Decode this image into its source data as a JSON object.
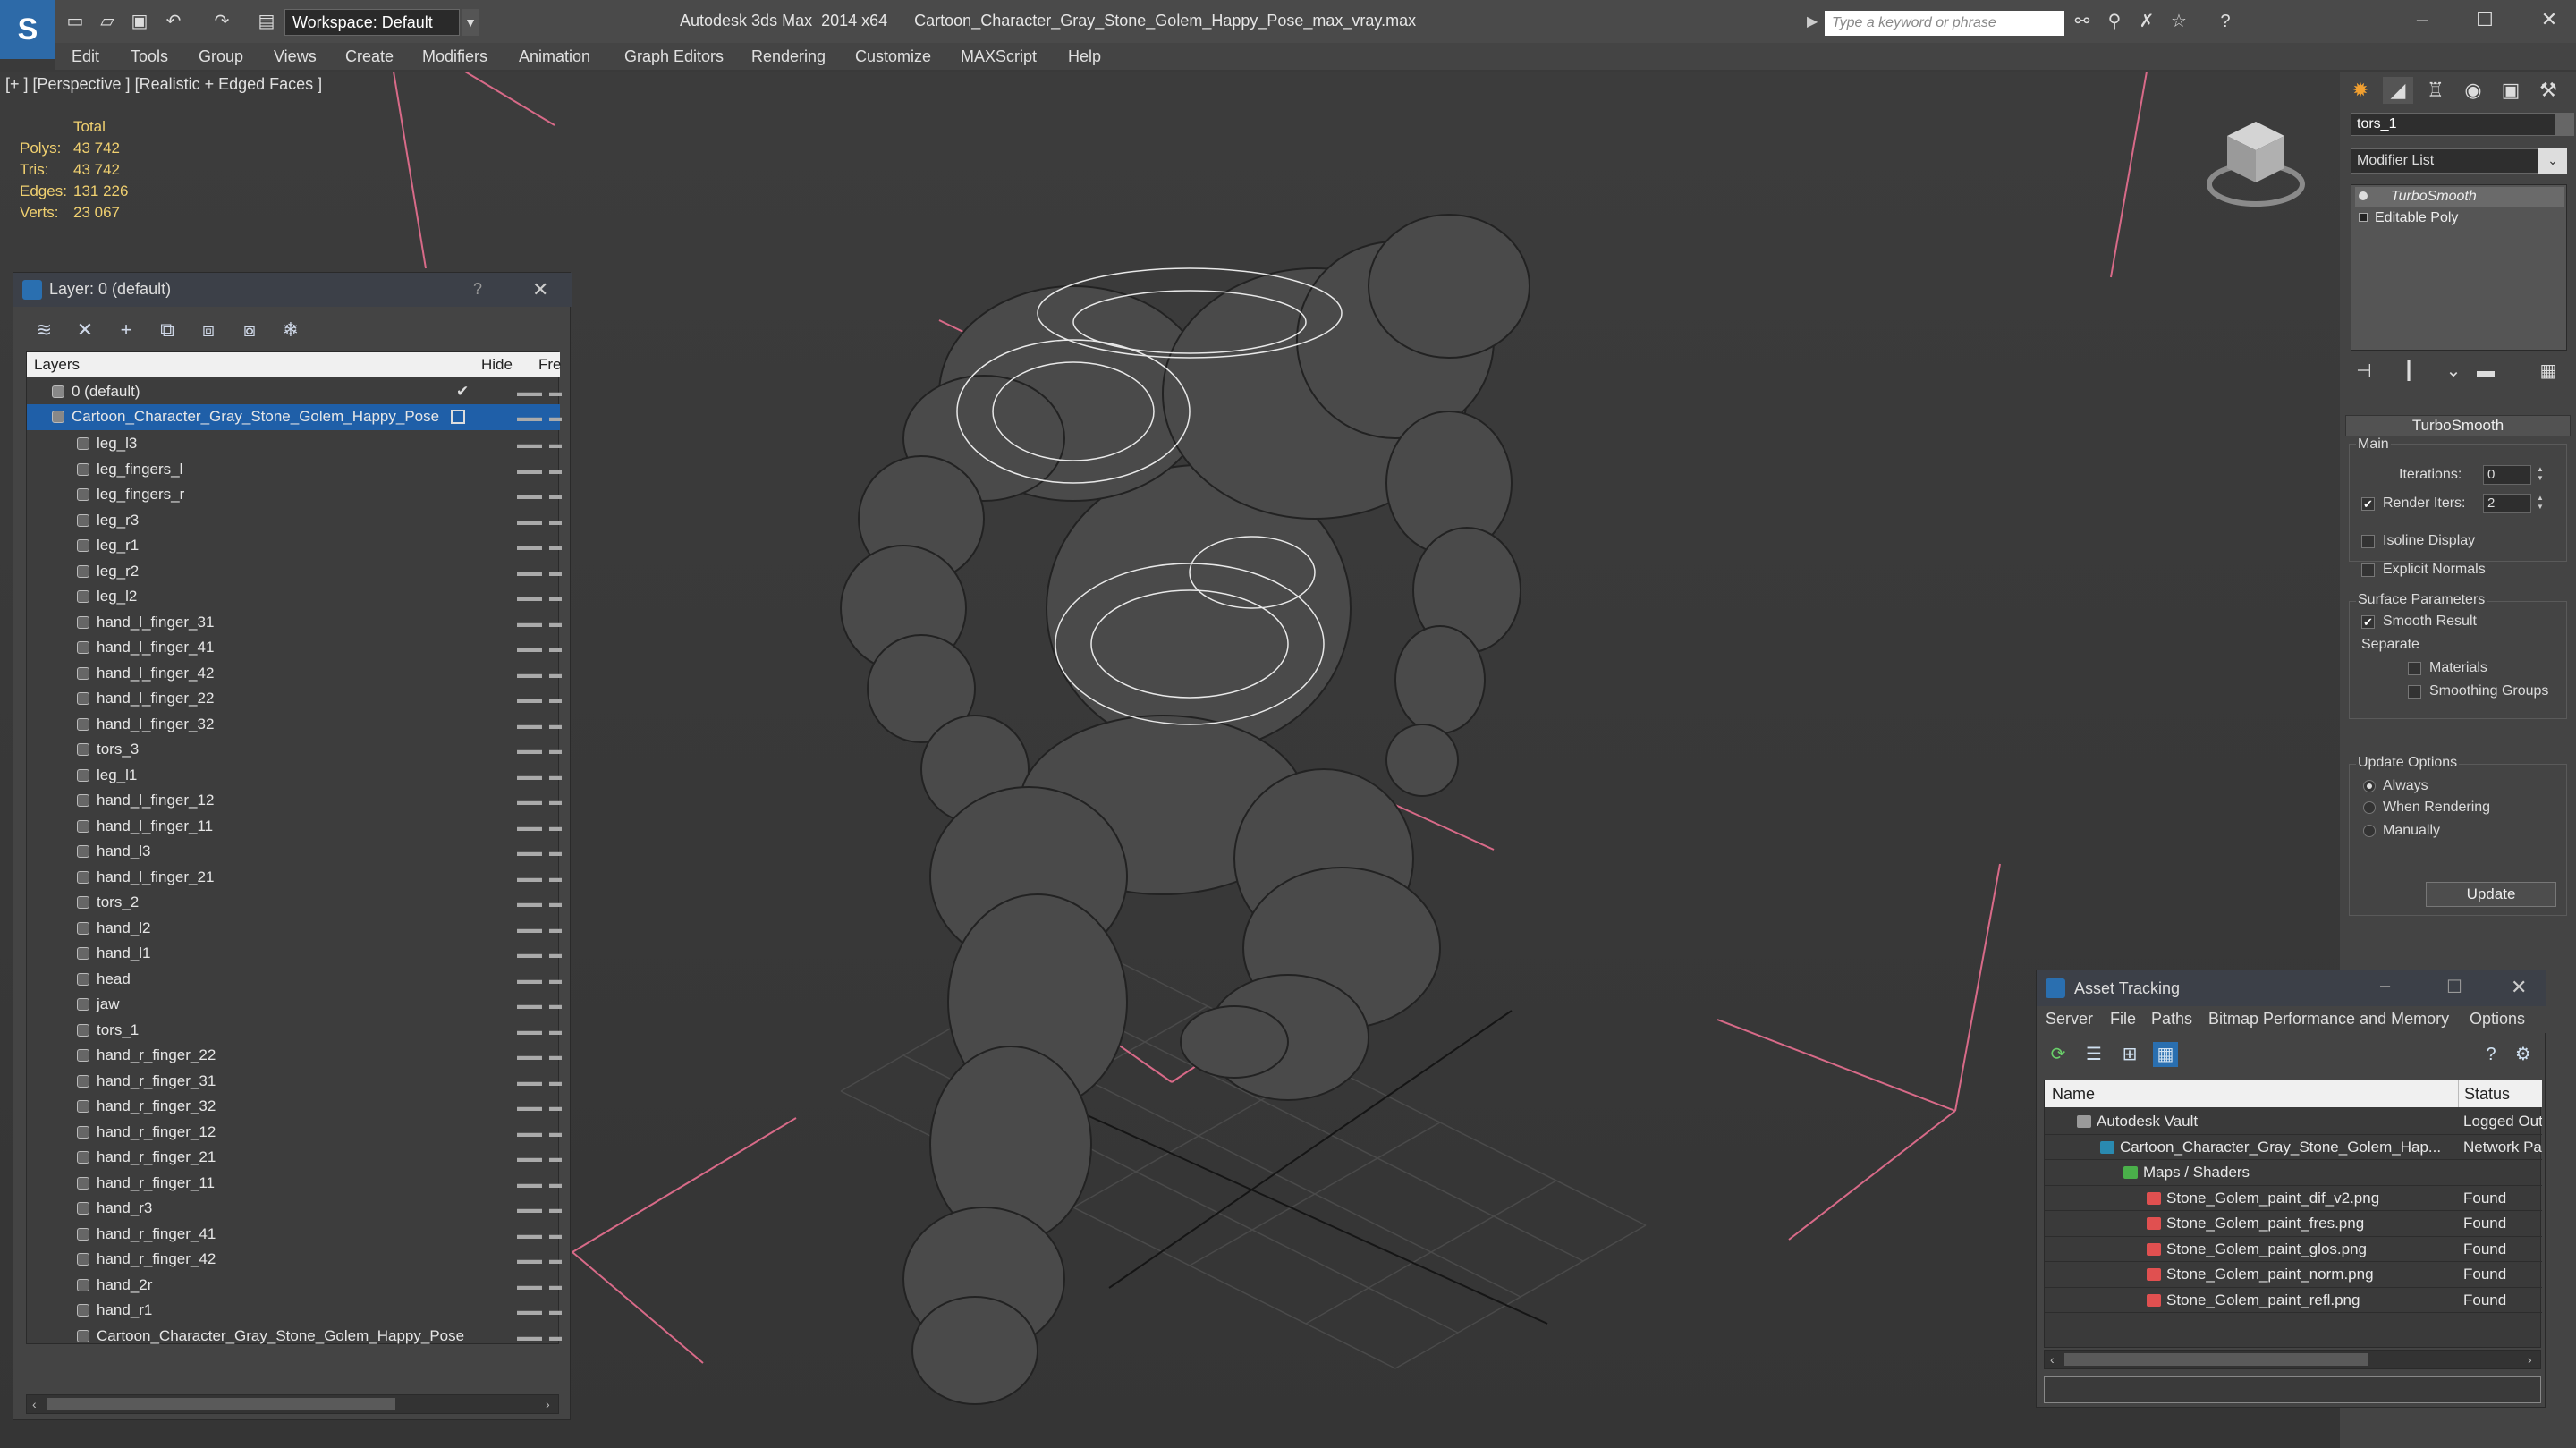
{
  "app": {
    "window_title": "Autodesk 3ds Max  2014 x64      Cartoon_Character_Gray_Stone_Golem_Happy_Pose_max_vray.max",
    "workspace": "Workspace: Default",
    "search_placeholder": "Type a keyword or phrase"
  },
  "menu": [
    "Edit",
    "Tools",
    "Group",
    "Views",
    "Create",
    "Modifiers",
    "Animation",
    "Graph Editors",
    "Rendering",
    "Customize",
    "MAXScript",
    "Help"
  ],
  "viewport": {
    "label": "[+ ] [Perspective ] [Realistic + Edged Faces ]",
    "stats": {
      "header": "Total",
      "rows": [
        {
          "label": "Polys:",
          "value": "43 742"
        },
        {
          "label": "Tris:",
          "value": "43 742"
        },
        {
          "label": "Edges:",
          "value": "131 226"
        },
        {
          "label": "Verts:",
          "value": "23 067"
        }
      ]
    }
  },
  "layer_panel": {
    "title": "Layer: 0 (default)",
    "help": "?",
    "col_layers": "Layers",
    "col_hide": "Hide",
    "col_freeze": "Fre",
    "default_layer": "0 (default)",
    "selected_layer": "Cartoon_Character_Gray_Stone_Golem_Happy_Pose",
    "objects": [
      "leg_l3",
      "leg_fingers_l",
      "leg_fingers_r",
      "leg_r3",
      "leg_r1",
      "leg_r2",
      "leg_l2",
      "hand_l_finger_31",
      "hand_l_finger_41",
      "hand_l_finger_42",
      "hand_l_finger_22",
      "hand_l_finger_32",
      "tors_3",
      "leg_l1",
      "hand_l_finger_12",
      "hand_l_finger_11",
      "hand_l3",
      "hand_l_finger_21",
      "tors_2",
      "hand_l2",
      "hand_l1",
      "head",
      "jaw",
      "tors_1",
      "hand_r_finger_22",
      "hand_r_finger_31",
      "hand_r_finger_32",
      "hand_r_finger_12",
      "hand_r_finger_21",
      "hand_r_finger_11",
      "hand_r3",
      "hand_r_finger_41",
      "hand_r_finger_42",
      "hand_2r",
      "hand_r1",
      "Cartoon_Character_Gray_Stone_Golem_Happy_Pose"
    ]
  },
  "command_panel": {
    "object_name": "tors_1",
    "modifier_list": "Modifier List",
    "stack": [
      "TurboSmooth",
      "Editable Poly"
    ],
    "rollout_title": "TurboSmooth",
    "main_label": "Main",
    "iterations_label": "Iterations:",
    "iterations_value": "0",
    "render_iters_label": "Render Iters:",
    "render_iters_value": "2",
    "isoline_label": "Isoline Display",
    "explicit_normals_label": "Explicit Normals",
    "surface_params_label": "Surface Parameters",
    "smooth_result_label": "Smooth Result",
    "separate_label": "Separate",
    "materials_label": "Materials",
    "smoothing_groups_label": "Smoothing Groups",
    "update_options_label": "Update Options",
    "always_label": "Always",
    "when_rendering_label": "When Rendering",
    "manually_label": "Manually",
    "update_button": "Update"
  },
  "asset_panel": {
    "title": "Asset Tracking",
    "menu": [
      "Server",
      "File",
      "Paths",
      "Bitmap Performance and Memory",
      "Options"
    ],
    "col_name": "Name",
    "col_status": "Status",
    "rows": [
      {
        "name": "Autodesk Vault",
        "status": "Logged Out",
        "indent": 0,
        "icon": "vault-icon"
      },
      {
        "name": "Cartoon_Character_Gray_Stone_Golem_Hap...",
        "status": "Network Pa",
        "indent": 1,
        "icon": "max-file-icon"
      },
      {
        "name": "Maps / Shaders",
        "status": "",
        "indent": 2,
        "icon": "maps-folder-icon"
      },
      {
        "name": "Stone_Golem_paint_dif_v2.png",
        "status": "Found",
        "indent": 3,
        "icon": "png-file-icon"
      },
      {
        "name": "Stone_Golem_paint_fres.png",
        "status": "Found",
        "indent": 3,
        "icon": "png-file-icon"
      },
      {
        "name": "Stone_Golem_paint_glos.png",
        "status": "Found",
        "indent": 3,
        "icon": "png-file-icon"
      },
      {
        "name": "Stone_Golem_paint_norm.png",
        "status": "Found",
        "indent": 3,
        "icon": "png-file-icon"
      },
      {
        "name": "Stone_Golem_paint_refl.png",
        "status": "Found",
        "indent": 3,
        "icon": "png-file-icon"
      }
    ]
  },
  "colors": {
    "accent": "#1f5fa8",
    "stats": "#f0d070",
    "selection": "#1f5fa8"
  }
}
